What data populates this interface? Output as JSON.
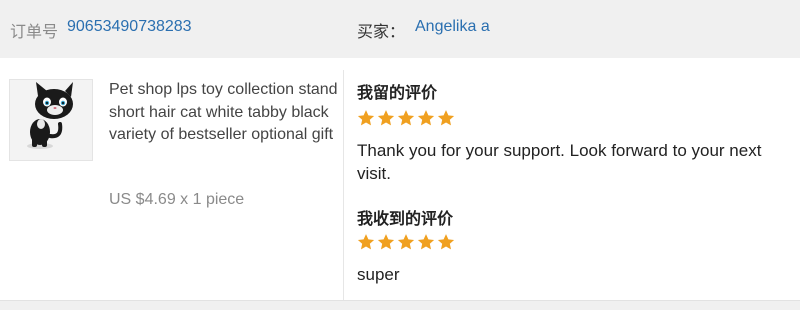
{
  "order": {
    "label": "订单号",
    "number": "90653490738283"
  },
  "buyer": {
    "label": "买家：",
    "name": "Angelika a"
  },
  "product": {
    "title": "Pet shop lps toy collection stand short hair cat white tabby black variety of bestseller optional gift",
    "price": "US $4.69 x 1 piece",
    "image_desc_icon": "black-cat-toy-thumbnail"
  },
  "my_review": {
    "title": "我留的评价",
    "rating": 5,
    "max_rating": 5,
    "text": "Thank you for your support. Look forward to your next visit."
  },
  "received_review": {
    "title": "我收到的评价",
    "rating": 5,
    "max_rating": 5,
    "text": "super"
  },
  "colors": {
    "link": "#2a6fb0",
    "star": "#f0a020",
    "header_bg": "#f0f0f0"
  }
}
